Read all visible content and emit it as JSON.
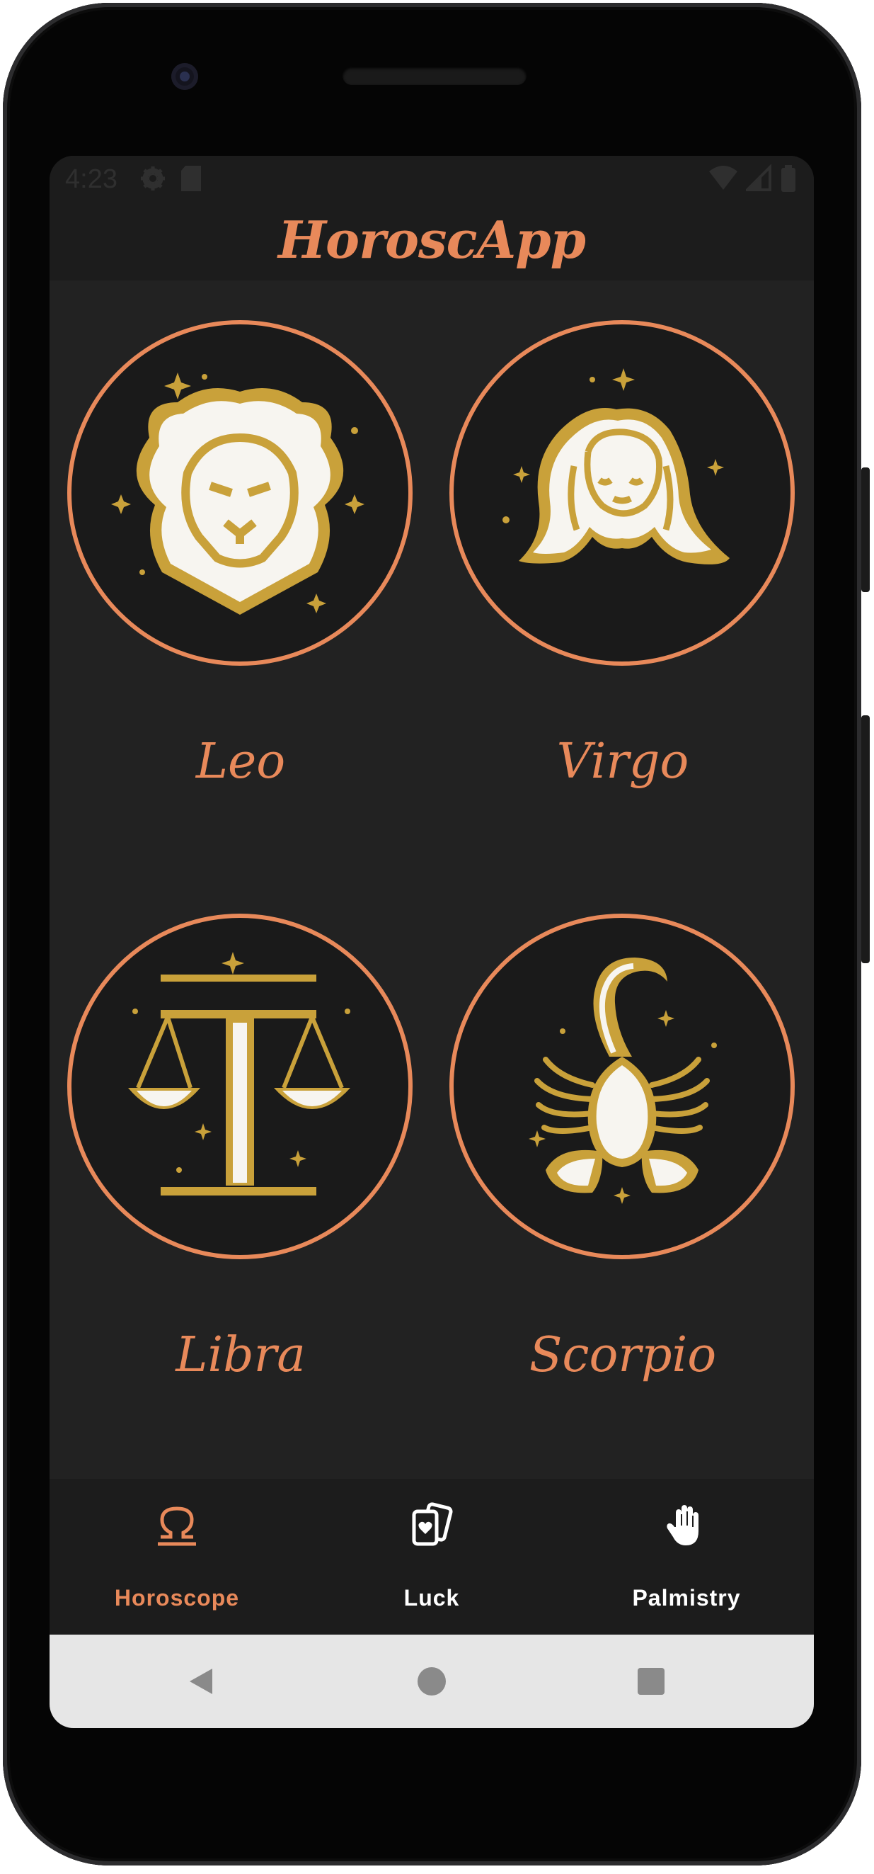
{
  "status_bar": {
    "time": "4:23",
    "icons": [
      "settings-gear-icon",
      "sd-card-icon",
      "wifi-icon",
      "cellular-signal-icon",
      "battery-icon"
    ]
  },
  "app_bar": {
    "title": "HoroscApp"
  },
  "signs": [
    {
      "name": "Leo",
      "icon": "leo-lion-icon"
    },
    {
      "name": "Virgo",
      "icon": "virgo-maiden-icon"
    },
    {
      "name": "Libra",
      "icon": "libra-scales-icon"
    },
    {
      "name": "Scorpio",
      "icon": "scorpio-scorpion-icon"
    }
  ],
  "bottom_nav": {
    "items": [
      {
        "label": "Horoscope",
        "icon": "omega-icon",
        "selected": true
      },
      {
        "label": "Luck",
        "icon": "cards-icon",
        "selected": false
      },
      {
        "label": "Palmistry",
        "icon": "hand-icon",
        "selected": false
      }
    ]
  },
  "system_nav": {
    "buttons": [
      "back-icon",
      "home-icon",
      "recents-icon"
    ]
  },
  "colors": {
    "accent": "#e8895a",
    "background": "#222222",
    "bar": "#1c1c1c",
    "gold": "#c9a13a",
    "icon_white": "#f7f5f0",
    "nav_unselected": "#ffffff",
    "system_nav": "#e6e6e6"
  }
}
